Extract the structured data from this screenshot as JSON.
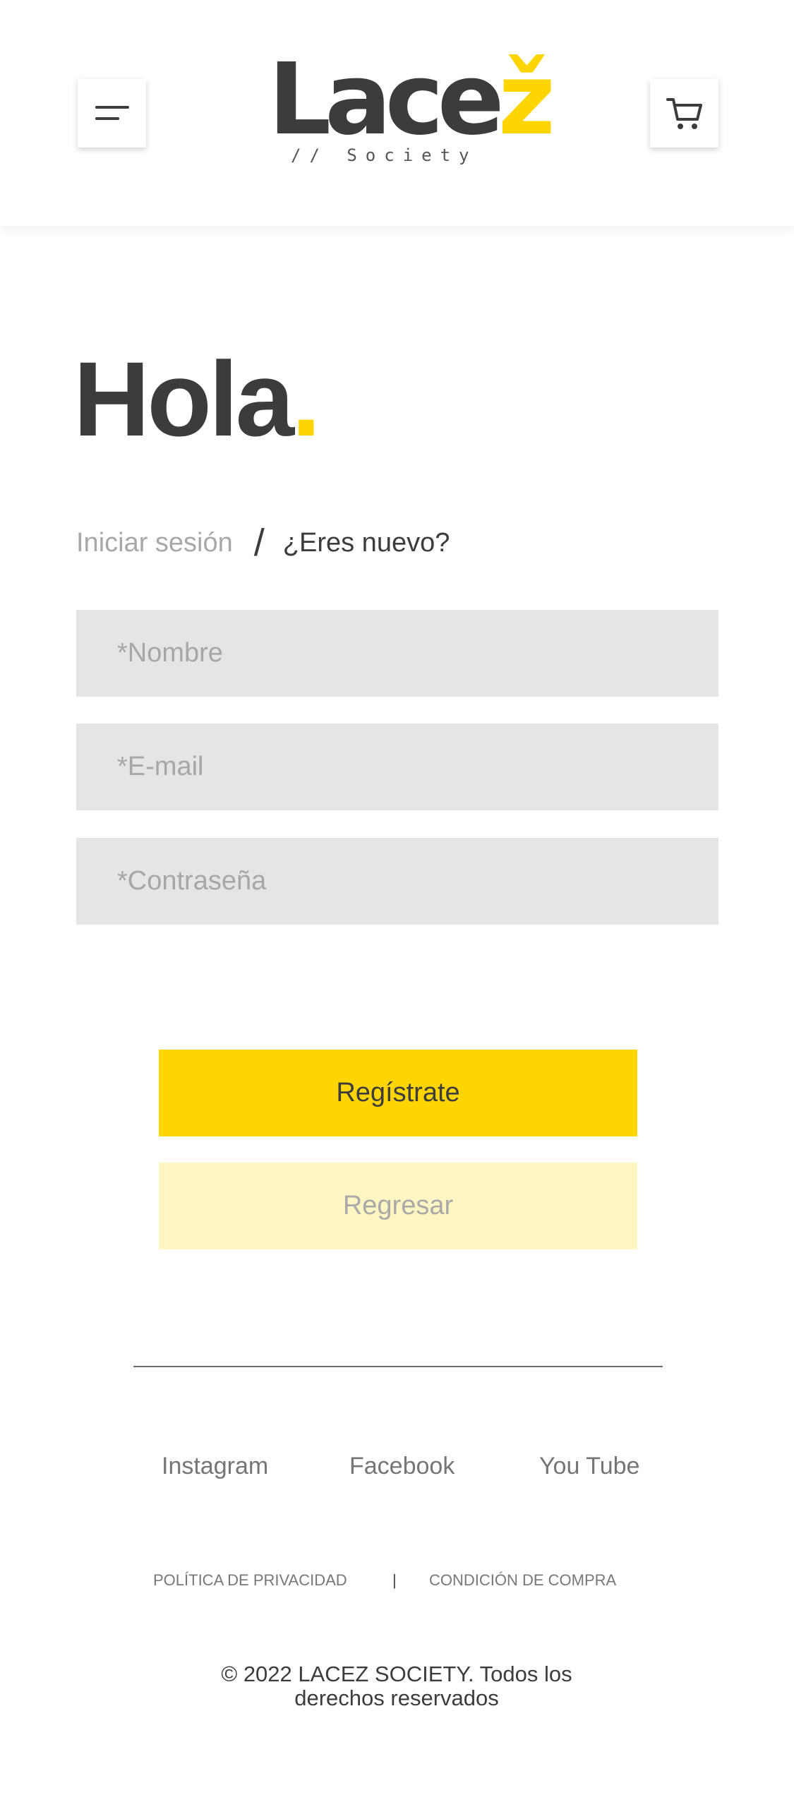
{
  "header": {
    "logo_main": "Lace",
    "logo_accent": "ž",
    "logo_sub": "// Society",
    "menu_icon": "hamburger-menu-icon",
    "cart_icon": "shopping-cart-icon"
  },
  "greeting": {
    "text": "Hola",
    "dot": "."
  },
  "auth_tabs": {
    "login": "Iniciar sesión",
    "separator": "/",
    "register": "¿Eres nuevo?"
  },
  "form": {
    "name_placeholder": "*Nombre",
    "email_placeholder": "*E-mail",
    "password_placeholder": "*Contraseña"
  },
  "buttons": {
    "register": "Regístrate",
    "back": "Regresar"
  },
  "footer": {
    "social": [
      "Instagram",
      "Facebook",
      "You Tube"
    ],
    "privacy": "POLÍTICA DE PRIVACIDAD",
    "separator": "|",
    "purchase_conditions": "CONDICIÓN DE COMPRA",
    "copyright": "© 2022 LACEZ SOCIETY. Todos los derechos reservados"
  },
  "colors": {
    "accent": "#ffd500",
    "accent_light": "#fff5c2",
    "text_dark": "#3c3c3c",
    "field_bg": "#e5e5e5"
  }
}
